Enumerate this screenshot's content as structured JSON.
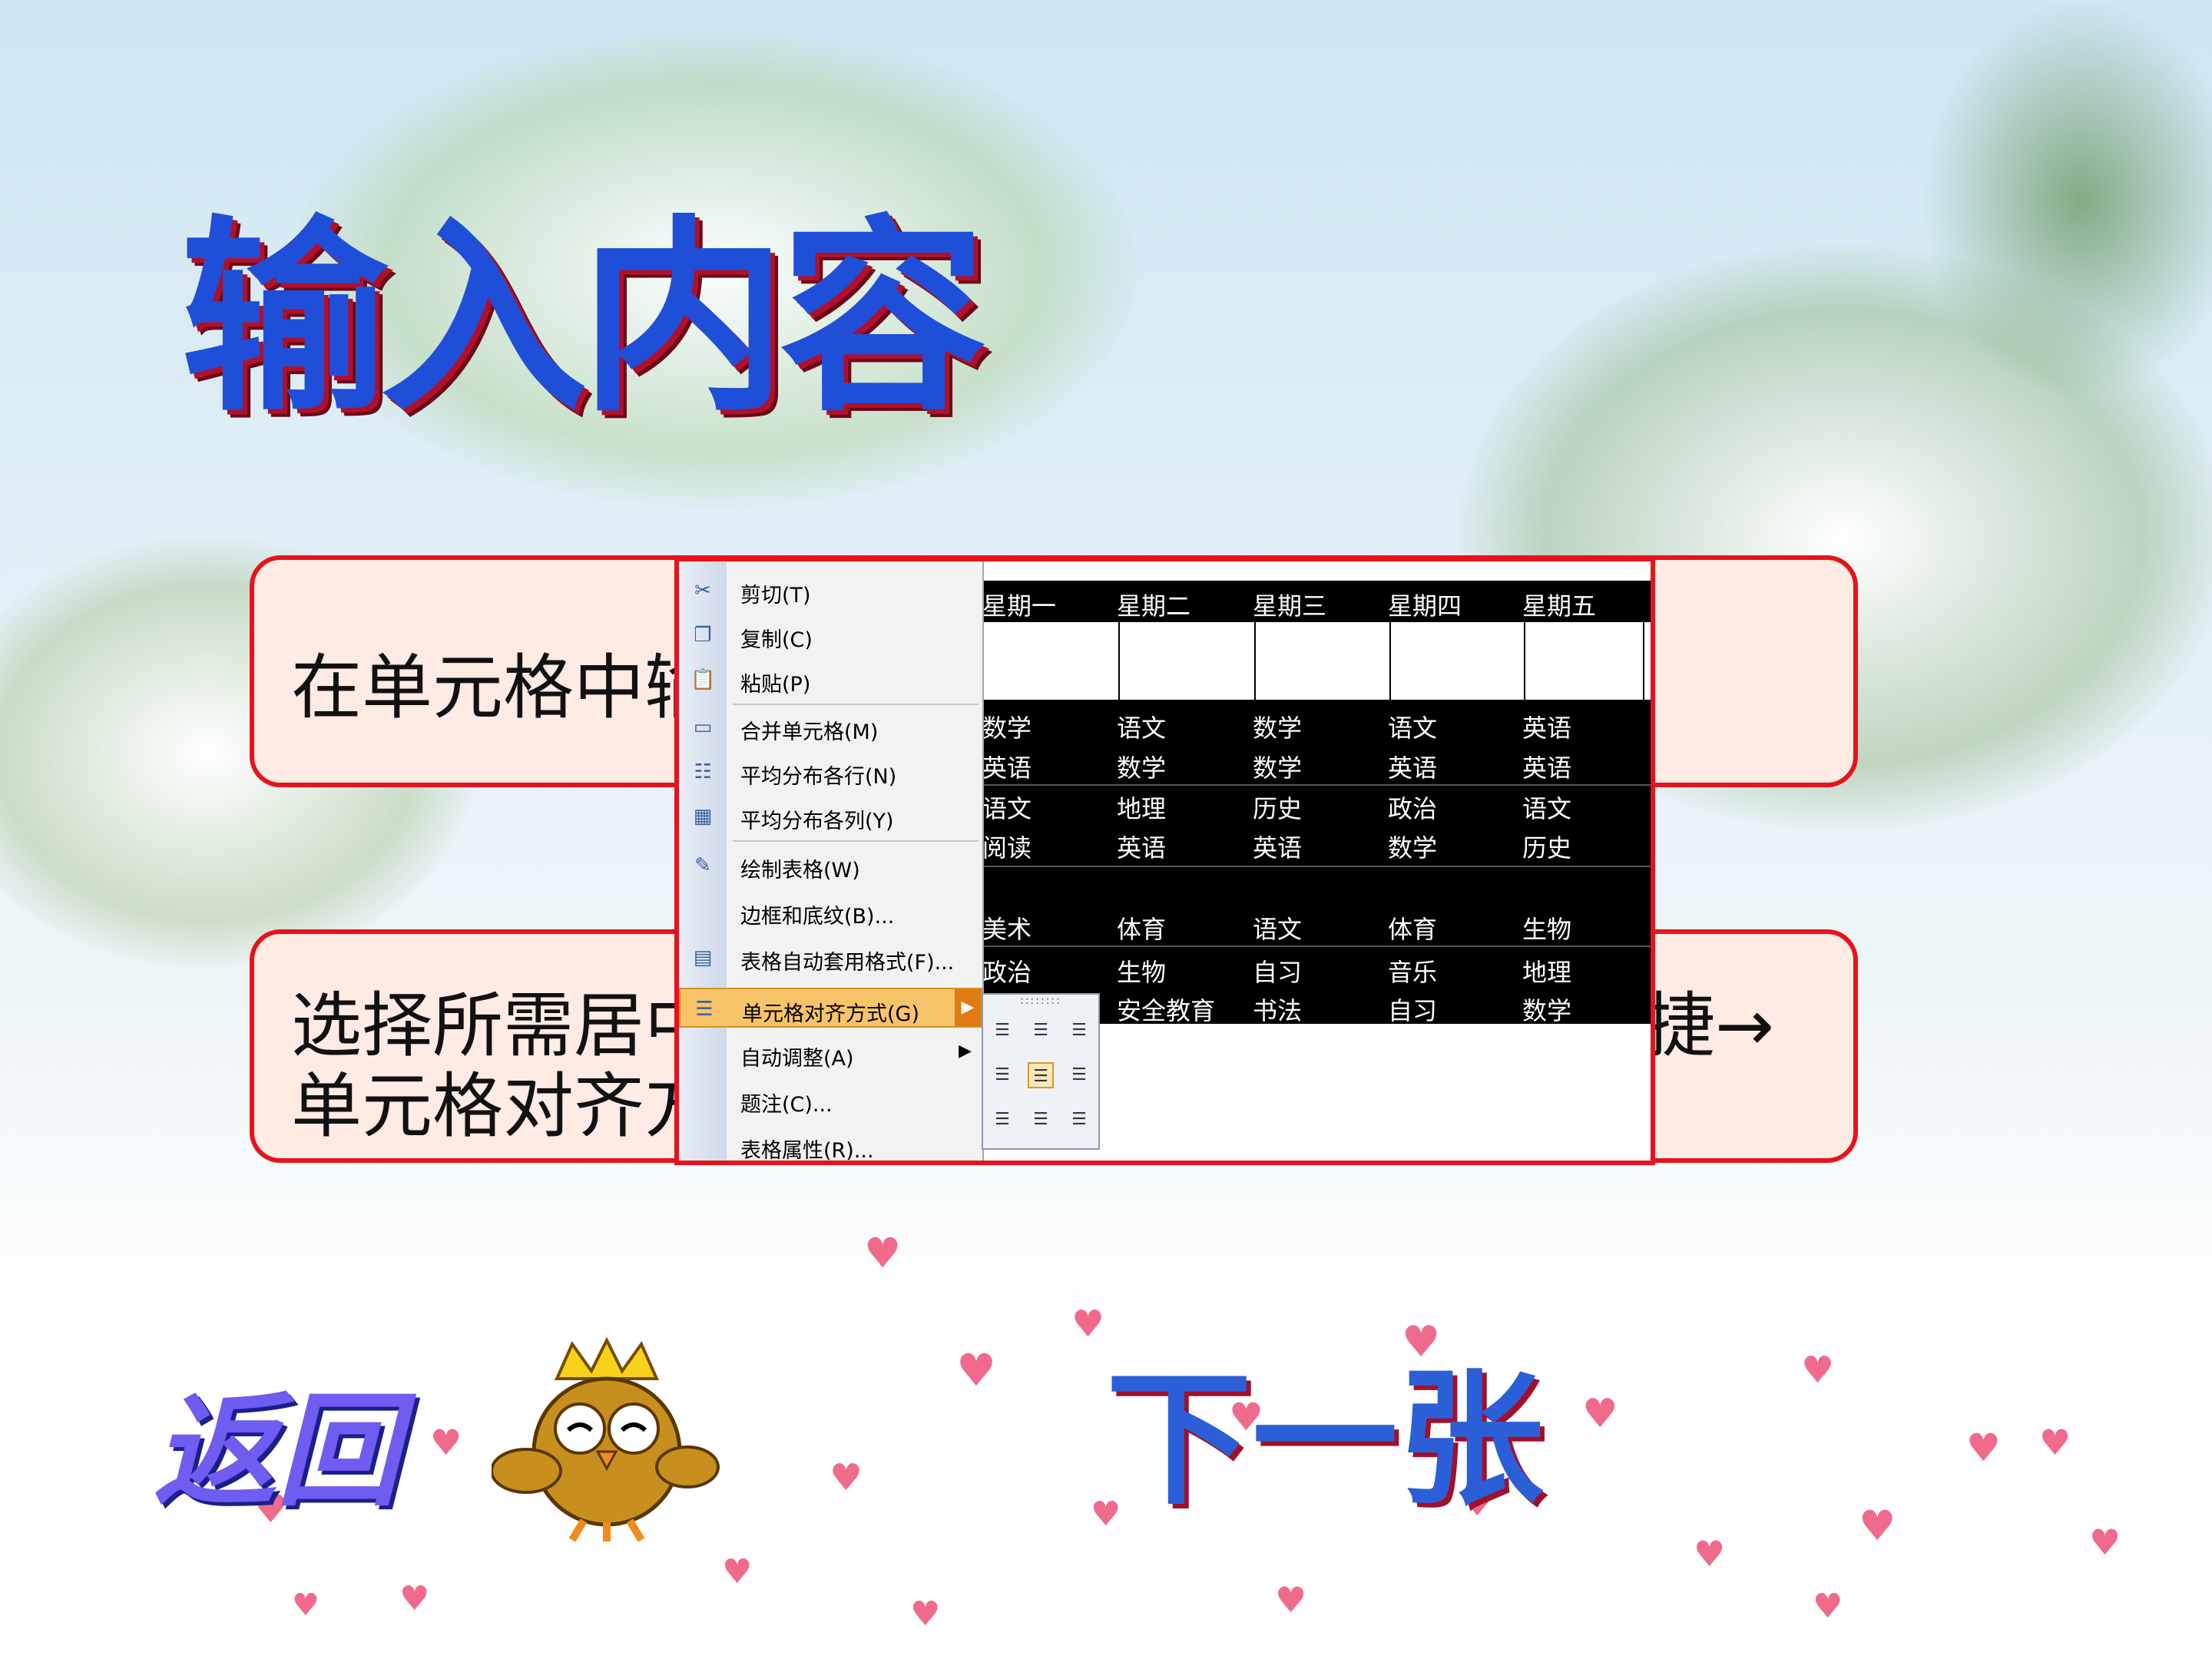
{
  "slide": {
    "title": "输入内容",
    "callout1_text": "在单元格中输",
    "callout2_line1": "选择所需居中",
    "callout2_line2": "单元格对齐方",
    "callout2_tail": "捷→",
    "nav_back": "返回",
    "nav_next": "下一张"
  },
  "context_menu": {
    "items": [
      {
        "label": "剪切(T)",
        "icon": "scissors-icon"
      },
      {
        "label": "复制(C)",
        "icon": "copy-icon"
      },
      {
        "label": "粘贴(P)",
        "icon": "paste-icon"
      },
      {
        "label": "合并单元格(M)",
        "icon": "merge-cells-icon"
      },
      {
        "label": "平均分布各行(N)",
        "icon": "distribute-rows-icon"
      },
      {
        "label": "平均分布各列(Y)",
        "icon": "distribute-columns-icon"
      },
      {
        "label": "绘制表格(W)",
        "icon": "draw-table-icon"
      },
      {
        "label": "边框和底纹(B)...",
        "icon": ""
      },
      {
        "label": "表格自动套用格式(F)...",
        "icon": "autoformat-icon"
      },
      {
        "label": "单元格对齐方式(G)",
        "icon": "align-icon",
        "selected": true,
        "submenu": true
      },
      {
        "label": "自动调整(A)",
        "icon": "",
        "submenu": true
      },
      {
        "label": "题注(C)...",
        "icon": ""
      },
      {
        "label": "表格属性(R)...",
        "icon": ""
      }
    ]
  },
  "align_submenu": {
    "header": "::::::::",
    "selected_index": 4
  },
  "timetable": {
    "headers": [
      "星期一",
      "星期二",
      "星期三",
      "星期四",
      "星期五"
    ],
    "rows": [
      [
        "数学",
        "语文",
        "数学",
        "语文",
        "英语"
      ],
      [
        "英语",
        "数学",
        "数学",
        "英语",
        "英语"
      ],
      [
        "语文",
        "地理",
        "历史",
        "政治",
        "语文"
      ],
      [
        "阅读",
        "英语",
        "英语",
        "数学",
        "历史"
      ],
      [
        "美术",
        "体育",
        "语文",
        "体育",
        "生物"
      ],
      [
        "政治",
        "生物",
        "自习",
        "音乐",
        "地理"
      ],
      [
        "",
        "安全教育",
        "书法",
        "自习",
        "数学"
      ]
    ]
  },
  "colors": {
    "accent_red": "#e8121c",
    "title_blue": "#1f4fd8",
    "menu_highlight": "#f7c46a"
  }
}
